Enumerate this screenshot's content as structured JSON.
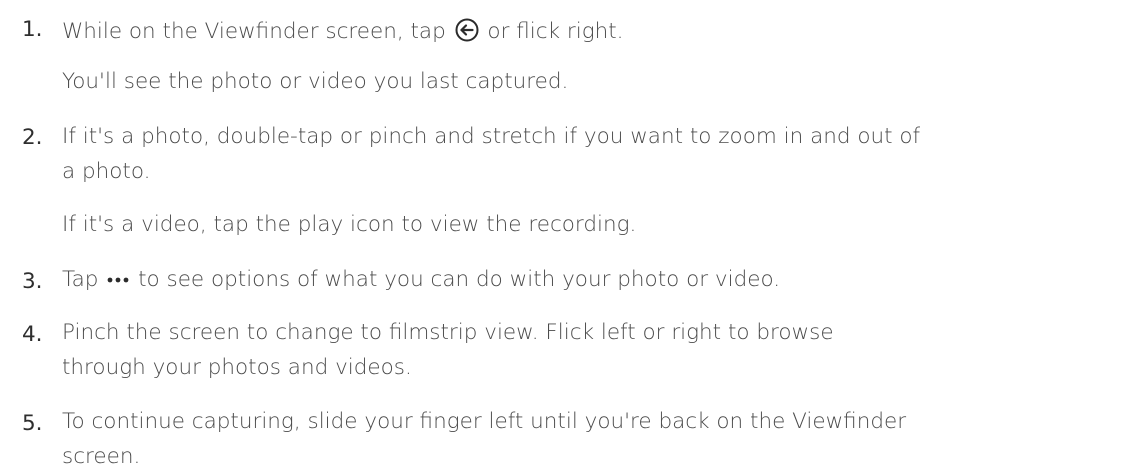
{
  "steps": [
    {
      "number": "1.",
      "line1_before_icon": "While on the Viewfinder screen, tap ",
      "line1_icon": "back-arrow-circle-icon",
      "line1_after_icon": " or flick right.",
      "note": "You'll see the photo or video you last captured."
    },
    {
      "number": "2.",
      "line1": "If it's a photo, double-tap or pinch and stretch if you want to zoom in and out of",
      "line2": "a photo.",
      "note": "If it's a video, tap the play icon to view the recording."
    },
    {
      "number": "3.",
      "line1_before_icon": "Tap ",
      "line1_icon": "more-options-dots-icon",
      "line1_after_icon": " to see options of what you can do with your photo or video."
    },
    {
      "number": "4.",
      "line1": "Pinch the screen to change to filmstrip view. Flick left or right to browse",
      "line2": "through your photos and videos."
    },
    {
      "number": "5.",
      "line1": "To continue capturing, slide your finger left until you're back on the Viewfinder",
      "line2": "screen."
    }
  ]
}
